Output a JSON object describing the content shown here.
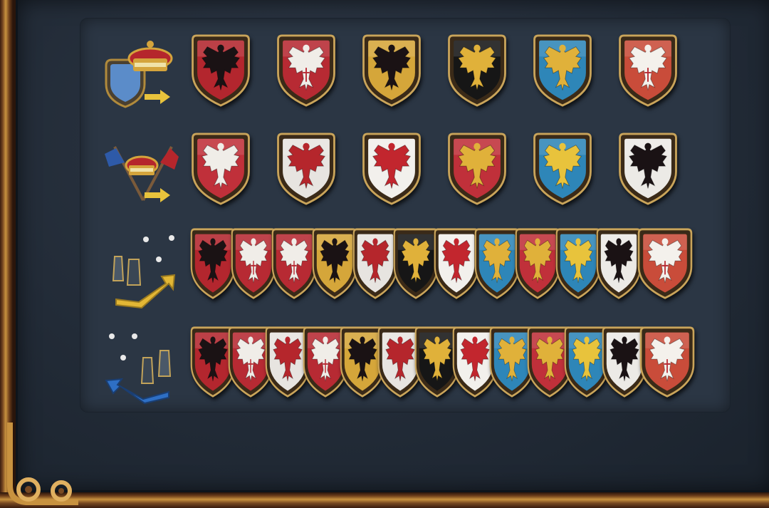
{
  "rows": [
    {
      "id": "independent",
      "icon": "crown-shield-arrow-icon",
      "shields": [
        {
          "field": "#b3262e",
          "eagle": "#1a1214",
          "cross": false
        },
        {
          "field": "#b72a33",
          "eagle": "#f0ede8",
          "cross": true
        },
        {
          "field": "#d5a63a",
          "eagle": "#1a1214",
          "cross": false
        },
        {
          "field": "#161616",
          "eagle": "#e0b13a",
          "cross": false
        },
        {
          "field": "#2e86b8",
          "eagle": "#e0b13a",
          "cross": false
        },
        {
          "field": "#c94c3a",
          "eagle": "#f4f1ec",
          "cross": true
        }
      ]
    },
    {
      "id": "union",
      "icon": "crossed-flags-crown-icon",
      "shields": [
        {
          "field": "#c0303a",
          "eagle": "#f0ede8",
          "cross": false
        },
        {
          "field": "#e7e4e0",
          "eagle": "#b5262c",
          "cross": false
        },
        {
          "field": "#f2f0ec",
          "eagle": "#c2262e",
          "cross": false
        },
        {
          "field": "#c0303a",
          "eagle": "#e0b13a",
          "cross": false
        },
        {
          "field": "#2e86b8",
          "eagle": "#e8c33c",
          "cross": false
        },
        {
          "field": "#eceae6",
          "eagle": "#1a1214",
          "cross": false
        }
      ]
    },
    {
      "id": "partition-a",
      "icon": "rising-pieces-gold-icon",
      "shields": [
        {
          "field": "#b3262e",
          "eagle": "#1a1214",
          "cross": false
        },
        {
          "field": "#b72a33",
          "eagle": "#f0ede8",
          "cross": true
        },
        {
          "field": "#b72a33",
          "eagle": "#f0ede8",
          "cross": true
        },
        {
          "field": "#d5a63a",
          "eagle": "#1a1214",
          "cross": false
        },
        {
          "field": "#e7e4e0",
          "eagle": "#b5262c",
          "cross": false
        },
        {
          "field": "#161616",
          "eagle": "#e0b13a",
          "cross": false
        },
        {
          "field": "#f2f0ec",
          "eagle": "#c2262e",
          "cross": false
        },
        {
          "field": "#2e86b8",
          "eagle": "#e0b13a",
          "cross": false
        },
        {
          "field": "#c0303a",
          "eagle": "#e0b13a",
          "cross": false
        },
        {
          "field": "#2e86b8",
          "eagle": "#e8c33c",
          "cross": false
        },
        {
          "field": "#eceae6",
          "eagle": "#1a1214",
          "cross": false
        },
        {
          "field": "#c94c3a",
          "eagle": "#f4f1ec",
          "cross": true
        }
      ]
    },
    {
      "id": "partition-b",
      "icon": "falling-pieces-blue-icon",
      "shields": [
        {
          "field": "#b3262e",
          "eagle": "#1a1214",
          "cross": false
        },
        {
          "field": "#b72a33",
          "eagle": "#f0ede8",
          "cross": true
        },
        {
          "field": "#e7e4e0",
          "eagle": "#b5262c",
          "cross": false
        },
        {
          "field": "#b72a33",
          "eagle": "#f0ede8",
          "cross": true
        },
        {
          "field": "#d5a63a",
          "eagle": "#1a1214",
          "cross": false
        },
        {
          "field": "#e7e4e0",
          "eagle": "#b5262c",
          "cross": false
        },
        {
          "field": "#161616",
          "eagle": "#e0b13a",
          "cross": false
        },
        {
          "field": "#f2f0ec",
          "eagle": "#c2262e",
          "cross": false
        },
        {
          "field": "#2e86b8",
          "eagle": "#e0b13a",
          "cross": false
        },
        {
          "field": "#c0303a",
          "eagle": "#e0b13a",
          "cross": false
        },
        {
          "field": "#2e86b8",
          "eagle": "#e8c33c",
          "cross": false
        },
        {
          "field": "#eceae6",
          "eagle": "#1a1214",
          "cross": false
        },
        {
          "field": "#c94c3a",
          "eagle": "#f4f1ec",
          "cross": true
        }
      ]
    }
  ]
}
